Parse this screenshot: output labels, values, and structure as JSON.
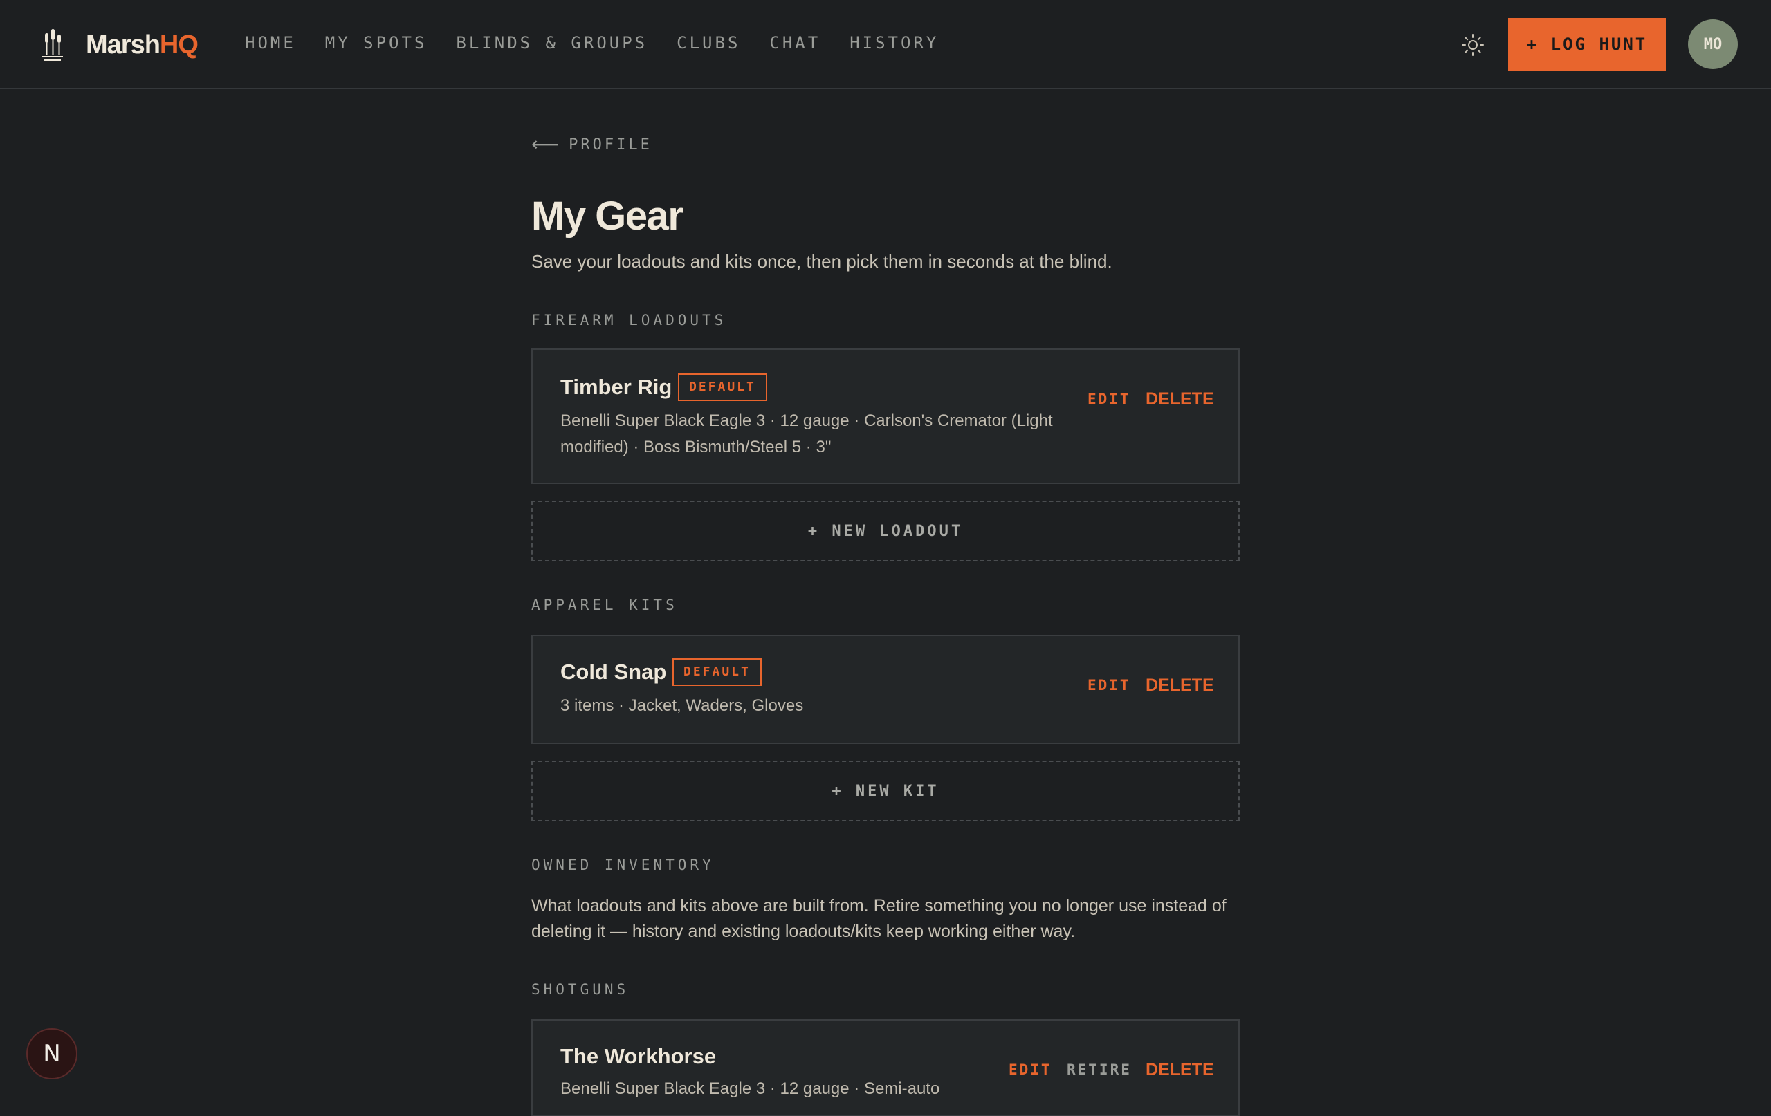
{
  "brand": {
    "name_part1": "Marsh",
    "name_part2": "HQ"
  },
  "nav": {
    "items": [
      {
        "label": "HOME"
      },
      {
        "label": "MY SPOTS"
      },
      {
        "label": "BLINDS & GROUPS"
      },
      {
        "label": "CLUBS"
      },
      {
        "label": "CHAT"
      },
      {
        "label": "HISTORY"
      }
    ]
  },
  "header": {
    "theme_icon": "sun-icon",
    "log_hunt_label": "+ LOG HUNT",
    "avatar_initials": "MO"
  },
  "page": {
    "back_arrow": "⟵",
    "back_label": "PROFILE",
    "title": "My Gear",
    "subtitle": "Save your loadouts and kits once, then pick them in seconds at the blind."
  },
  "firearm_loadouts": {
    "section_label": "FIREARM LOADOUTS",
    "items": [
      {
        "name": "Timber Rig",
        "badge": "DEFAULT",
        "desc_line1": "Benelli Super Black Eagle 3 · 12 gauge · Carlson's Cremator (Light",
        "desc_line2": "modified) · Boss Bismuth/Steel 5 · 3\"",
        "edit_label": "EDIT",
        "delete_label": "DELETE"
      }
    ],
    "new_label": "+ NEW LOADOUT"
  },
  "apparel_kits": {
    "section_label": "APPAREL KITS",
    "items": [
      {
        "name": "Cold Snap",
        "badge": "DEFAULT",
        "desc": "3 items · Jacket, Waders, Gloves",
        "edit_label": "EDIT",
        "delete_label": "DELETE"
      }
    ],
    "new_label": "+ NEW KIT"
  },
  "owned_inventory": {
    "section_label": "OWNED INVENTORY",
    "description_line1": "What loadouts and kits above are built from. Retire something you no longer use instead of",
    "description_line2": "deleting it — history and existing loadouts/kits keep working either way.",
    "shotguns": {
      "section_label": "SHOTGUNS",
      "items": [
        {
          "name": "The Workhorse",
          "desc": "Benelli Super Black Eagle 3 · 12 gauge · Semi-auto",
          "edit_label": "EDIT",
          "retire_label": "RETIRE",
          "delete_label": "DELETE"
        }
      ]
    }
  },
  "fab": {
    "label": "N"
  },
  "colors": {
    "accent": "#e8652d",
    "background": "#1d1f21",
    "card": "#232628",
    "avatar": "#7c8a73"
  }
}
